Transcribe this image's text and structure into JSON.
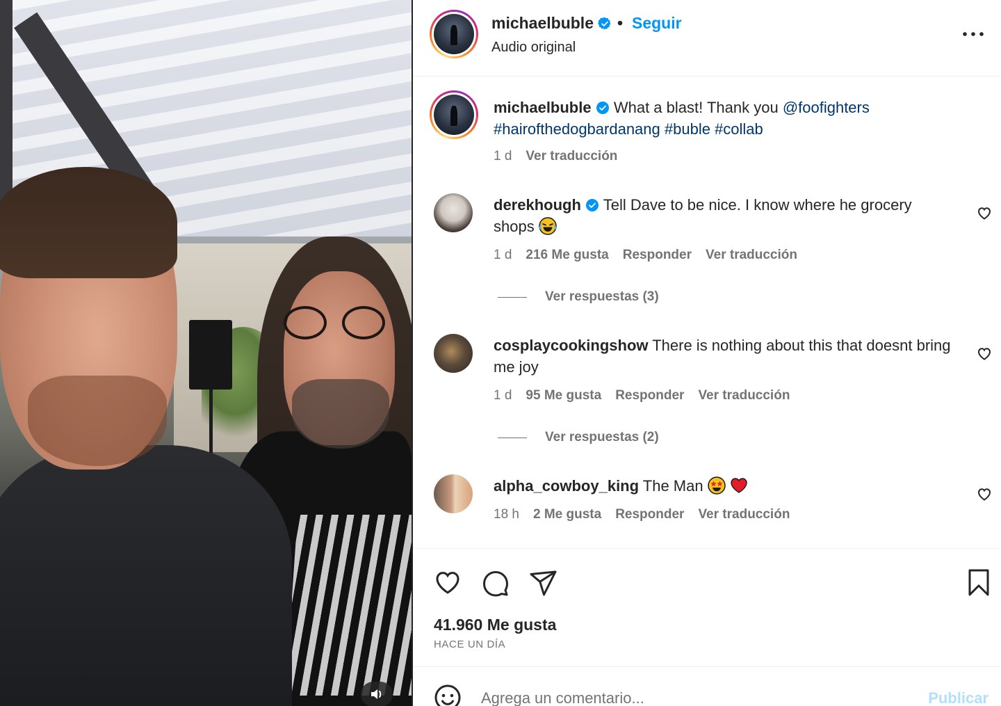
{
  "header": {
    "username": "michaelbuble",
    "separator": "•",
    "follow_label": "Seguir",
    "audio_label": "Audio original"
  },
  "caption": {
    "username": "michaelbuble",
    "text": "What a blast! Thank you",
    "mention": "@foofighters",
    "hashtags": "#hairofthedogbardanang #buble #collab",
    "time": "1 d",
    "translate": "Ver traducción"
  },
  "comments": [
    {
      "username": "derekhough",
      "verified": true,
      "text": "Tell Dave to be nice. I know where he grocery shops",
      "emoji": "laughing-tears-emoji",
      "time": "1 d",
      "likes": "216 Me gusta",
      "reply": "Responder",
      "translate": "Ver traducción",
      "view_replies": "Ver respuestas (3)"
    },
    {
      "username": "cosplaycookingshow",
      "verified": false,
      "text": "There is nothing about this that doesnt bring me joy",
      "time": "1 d",
      "likes": "95 Me gusta",
      "reply": "Responder",
      "translate": "Ver traducción",
      "view_replies": "Ver respuestas (2)"
    },
    {
      "username": "alpha_cowboy_king",
      "verified": false,
      "text": "The Man",
      "emoji": "star-eyes-emoji, red-heart-emoji",
      "time": "18 h",
      "likes": "2 Me gusta",
      "reply": "Responder",
      "translate": "Ver traducción"
    }
  ],
  "actions": {
    "likes_count": "41.960 Me gusta",
    "time_ago": "HACE UN DÍA"
  },
  "comment_box": {
    "placeholder": "Agrega un comentario...",
    "publish_label": "Publicar"
  },
  "colors": {
    "link_blue": "#0095f6",
    "mention_blue": "#00376b",
    "muted_text": "#737373",
    "publish_disabled": "#b2dffc"
  }
}
